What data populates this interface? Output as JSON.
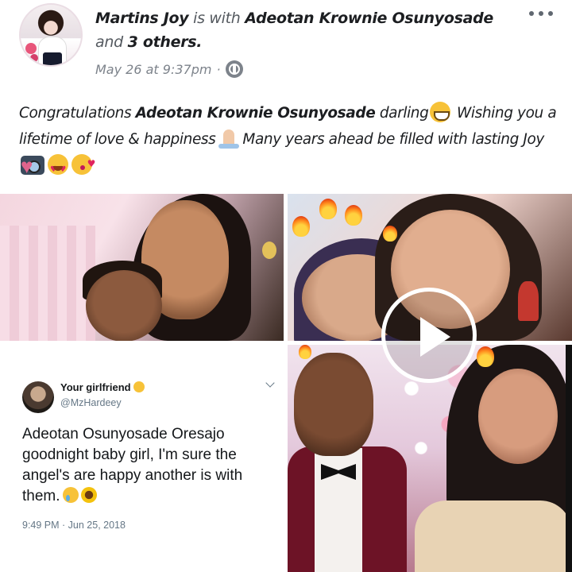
{
  "post": {
    "author": "Martins Joy",
    "with_text": "is with",
    "tagged": "Adeotan Krownie Osunyosade",
    "and_text": "and",
    "others": "3 others.",
    "timestamp": "May 26 at 9:37pm",
    "separator": "·",
    "audience_icon": "globe-icon",
    "more_icon": "more-options-icon",
    "text_part1": "Congratulations",
    "text_mention": "Adeotan Krownie Osunyosade",
    "text_part2": "darling",
    "text_part3": "Wishing you a lifetime of love & happiness",
    "text_part4": "Many years ahead be filled with lasting Joy"
  },
  "tweet": {
    "display_name": "Your girlfriend",
    "handle": "@MzHardeey",
    "body": "Adeotan Osunyosade Oresajo goodnight baby girl, I'm sure the angel's are happy another is with them.",
    "time": "9:49 PM · Jun 25, 2018"
  },
  "colors": {
    "author_name": "#1c1e21",
    "meta_gray": "#54595f",
    "heart_pink": "#e0648c",
    "tweet_gray": "#657786"
  }
}
